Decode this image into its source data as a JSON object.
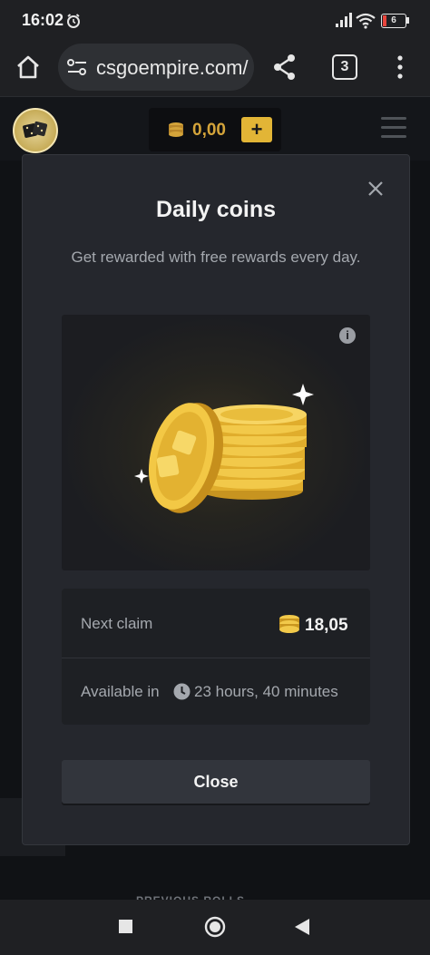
{
  "status_bar": {
    "time": "16:02",
    "battery": "6"
  },
  "browser": {
    "url": "csgoempire.com/",
    "tab_count": "3"
  },
  "site_header": {
    "balance": "0,00",
    "add_label": "+"
  },
  "background": {
    "previous_rolls": "PREVIOUS ROLLS"
  },
  "modal": {
    "title": "Daily coins",
    "subtitle": "Get rewarded with free rewards every day.",
    "info_label": "i",
    "next_claim_label": "Next claim",
    "next_claim_value": "18,05",
    "available_label": "Available in",
    "available_value": "23 hours, 40 minutes",
    "close_label": "Close"
  },
  "colors": {
    "gold": "#e2b536",
    "modal_bg": "#25272d",
    "page_bg": "#101215"
  }
}
